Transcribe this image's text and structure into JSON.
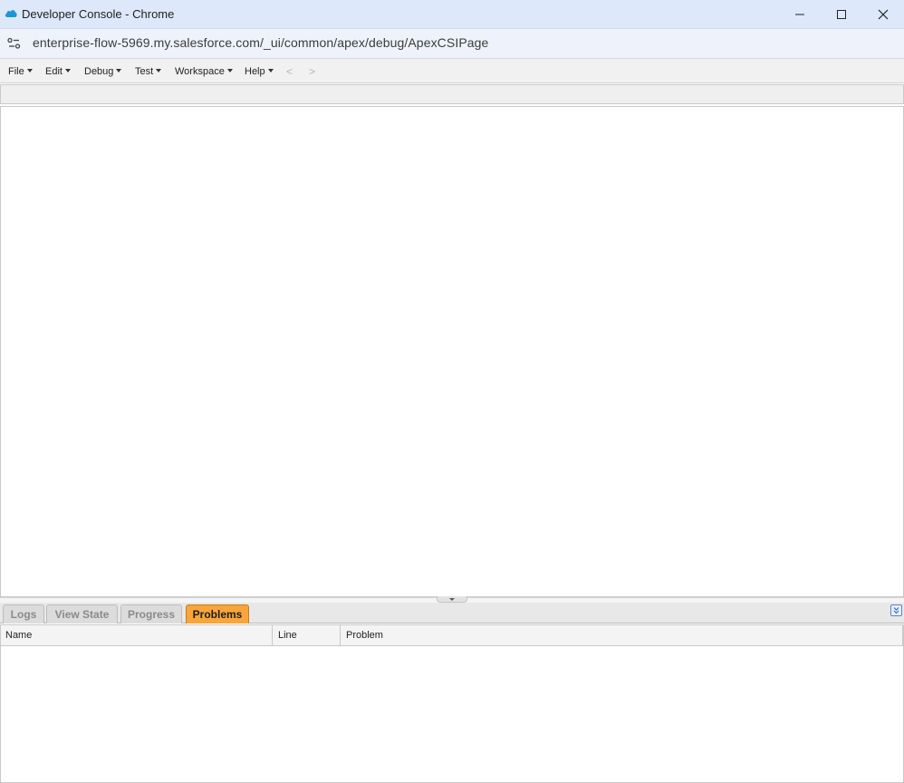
{
  "window": {
    "title": "Developer Console - Chrome"
  },
  "address_bar": {
    "url": "enterprise-flow-5969.my.salesforce.com/_ui/common/apex/debug/ApexCSIPage"
  },
  "menu": {
    "items": [
      "File",
      "Edit",
      "Debug",
      "Test",
      "Workspace",
      "Help"
    ],
    "back_arrow": "<",
    "forward_arrow": ">"
  },
  "bottom_panel": {
    "tabs": [
      "Logs",
      "View State",
      "Progress",
      "Problems"
    ],
    "active_tab": "Problems",
    "columns": [
      "Name",
      "Line",
      "Problem"
    ]
  },
  "colors": {
    "title_bar": "#dde8fa",
    "active_tab": "#f8a53b",
    "salesforce_blue": "#1b96d8"
  }
}
